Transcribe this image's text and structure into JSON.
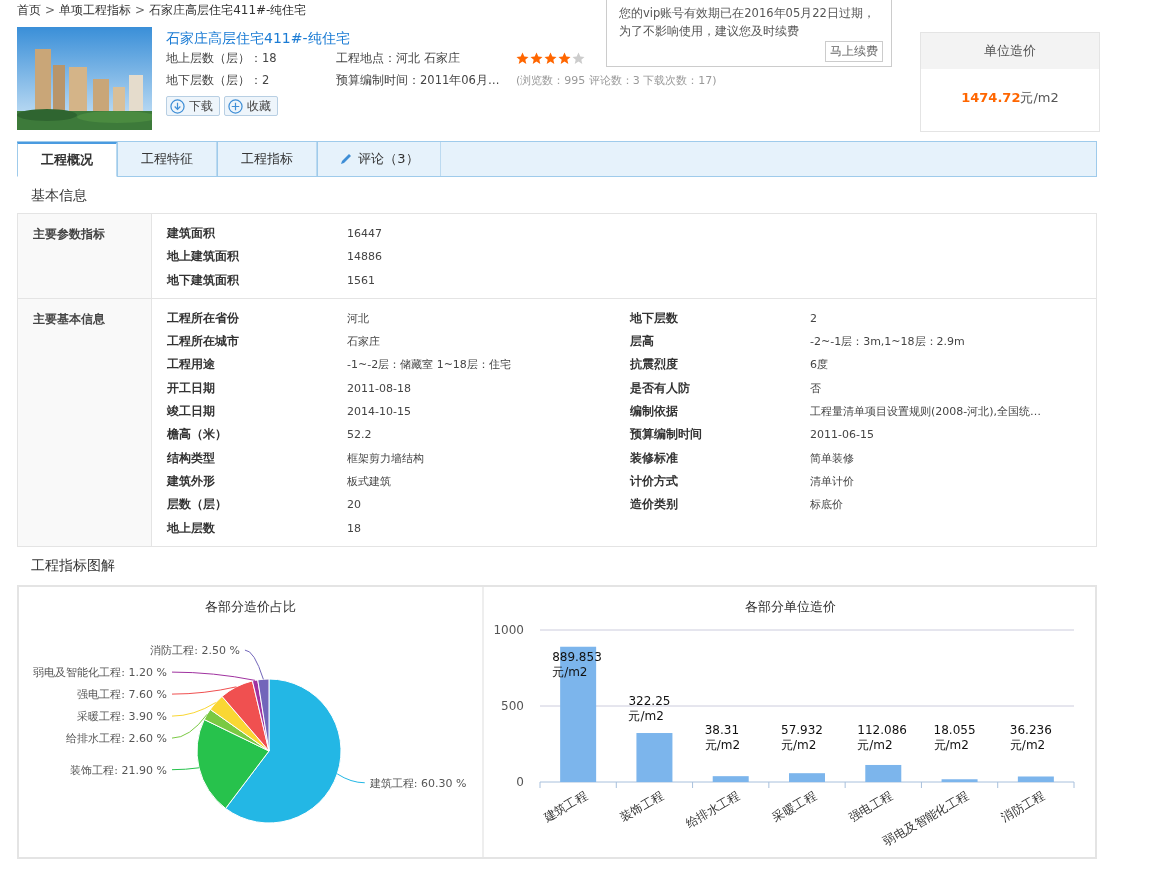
{
  "breadcrumb": [
    {
      "kind": "link",
      "text": "首页"
    },
    {
      "kind": "separator",
      "text": ">"
    },
    {
      "kind": "link",
      "text": "单项工程指标"
    },
    {
      "kind": "separator",
      "text": ">"
    },
    {
      "kind": "link",
      "text": "石家庄高层住宅411#-纯住宅"
    }
  ],
  "header": {
    "title": "石家庄高层住宅411#-纯住宅",
    "facts": [
      {
        "label": "地上层数（层）：",
        "value": "18"
      },
      {
        "label": "工程地点：",
        "value": "河北 石家庄"
      },
      {
        "label": "地下层数（层）：",
        "value": "2"
      },
      {
        "label": "预算编制时间：",
        "value": "2011年06月…"
      }
    ],
    "stars": 4,
    "stats": "(浏览数：995 评论数：3 下载次数：17)",
    "buttons": [
      {
        "kind": "download",
        "label": "下载"
      },
      {
        "kind": "add",
        "label": "收藏"
      }
    ]
  },
  "notice": {
    "message": "您的vip账号有效期已在2016年05月22日过期，为了不影响使用，建议您及时续费",
    "button": "马上续费"
  },
  "price": {
    "title": "单位造价",
    "value": "1474.72",
    "unit": "元/m2"
  },
  "tabs": [
    {
      "label": "工程概况",
      "selected": true
    },
    {
      "label": "工程特征",
      "selected": false
    },
    {
      "label": "工程指标",
      "selected": false
    },
    {
      "label": "评论（3）",
      "selected": false,
      "kind": "with_icon"
    }
  ],
  "basic": {
    "title": "基本信息",
    "groups": [
      {
        "name": "主要参数指标",
        "items": [
          {
            "key": "建筑面积",
            "value": "16447"
          },
          {
            "key": "地上建筑面积",
            "value": "14886"
          },
          {
            "key": "地下建筑面积",
            "value": "1561"
          }
        ]
      },
      {
        "name": "主要基本信息",
        "items": [
          {
            "key": "工程所在省份",
            "value": "河北"
          },
          {
            "key": "地下层数",
            "value": "2"
          },
          {
            "key": "工程所在城市",
            "value": "石家庄"
          },
          {
            "key": "层高",
            "value": "-2~-1层：3m,1~18层：2.9m"
          },
          {
            "key": "工程用途",
            "value": "-1~-2层：储藏室 1~18层：住宅"
          },
          {
            "key": "抗震烈度",
            "value": "6度"
          },
          {
            "key": "开工日期",
            "value": "2011-08-18"
          },
          {
            "key": "是否有人防",
            "value": "否"
          },
          {
            "key": "竣工日期",
            "value": "2014-10-15"
          },
          {
            "key": "编制依据",
            "value": "工程量清单项目设置规则(2008-河北),全国统…"
          },
          {
            "key": "檐高（米）",
            "value": "52.2"
          },
          {
            "key": "预算编制时间",
            "value": "2011-06-15"
          },
          {
            "key": "结构类型",
            "value": "框架剪力墙结构"
          },
          {
            "key": "装修标准",
            "value": "简单装修"
          },
          {
            "key": "建筑外形",
            "value": "板式建筑"
          },
          {
            "key": "计价方式",
            "value": "清单计价"
          },
          {
            "key": "层数（层）",
            "value": "20"
          },
          {
            "key": "造价类别",
            "value": "标底价"
          },
          {
            "key": "地上层数",
            "value": "18"
          }
        ]
      }
    ]
  },
  "charts": {
    "title": "工程指标图解",
    "pie": {
      "chart_data": {
        "type": "pie",
        "title": "各部分造价占比",
        "values": [
          60.3,
          21.9,
          2.6,
          3.9,
          7.6,
          1.2,
          2.5
        ],
        "colors": [
          "#23b7e5",
          "#27c24c",
          "#7ac943",
          "#fad733",
          "#f05050",
          "#a032a0",
          "#7266ba"
        ],
        "value_labels": [
          "建筑工程: 60.30 %",
          "装饰工程: 21.90 %",
          "给排水工程: 2.60 %",
          "采暖工程: 3.90 %",
          "强电工程: 7.60 %",
          "弱电及智能化工程: 1.20 %",
          "消防工程: 2.50 %"
        ]
      }
    },
    "bar": {
      "chart_data": {
        "type": "bar",
        "title": "各部分单位造价",
        "categories": [
          "建筑工程",
          "装饰工程",
          "给排水工程",
          "采暖工程",
          "强电工程",
          "弱电及智能化工程",
          "消防工程"
        ],
        "values": [
          889.853,
          322.25,
          38.31,
          57.932,
          112.086,
          18.055,
          36.236
        ],
        "ylim": [
          0,
          1000
        ],
        "yticks": [
          0,
          500,
          1000
        ],
        "value_labels": [
          "889.853 元/m2",
          "322.25 元/m2",
          "38.31 元/m2",
          "57.932 元/m2",
          "112.086 元/m2",
          "18.055 元/m2",
          "36.236 元/m2"
        ]
      }
    }
  }
}
